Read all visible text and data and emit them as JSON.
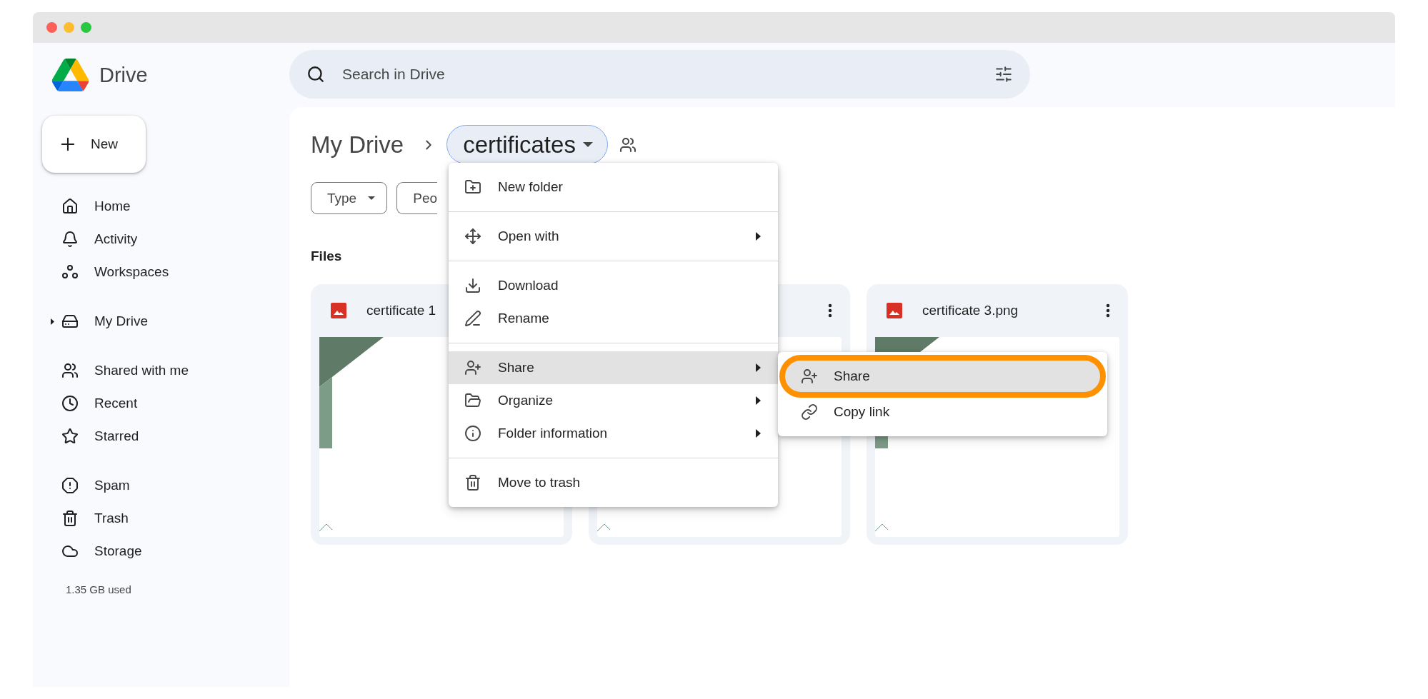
{
  "window": {
    "app_name": "Drive"
  },
  "search": {
    "placeholder": "Search in Drive"
  },
  "new_button": "New",
  "sidebar": {
    "groups": [
      {
        "items": [
          {
            "label": "Home"
          },
          {
            "label": "Activity"
          },
          {
            "label": "Workspaces"
          }
        ]
      },
      {
        "items": [
          {
            "label": "My Drive",
            "expanded": false
          }
        ]
      },
      {
        "items": [
          {
            "label": "Shared with me"
          },
          {
            "label": "Recent"
          },
          {
            "label": "Starred"
          }
        ]
      },
      {
        "items": [
          {
            "label": "Spam"
          },
          {
            "label": "Trash"
          },
          {
            "label": "Storage"
          }
        ]
      }
    ],
    "storage_used": "1.35 GB used"
  },
  "breadcrumb": {
    "root": "My Drive",
    "current": "certificates"
  },
  "filters": [
    {
      "label": "Type",
      "dropdown": true
    },
    {
      "label": "Peo",
      "dropdown": false
    }
  ],
  "section_title": "Files",
  "cards": [
    {
      "name": "certificate 1"
    },
    {
      "menu_button": true
    },
    {
      "name": "certificate 3.png",
      "menu_button": true
    }
  ],
  "context_menu": {
    "groups": [
      {
        "items": [
          {
            "label": "New folder",
            "submenu": false,
            "selected": false
          }
        ]
      },
      {
        "items": [
          {
            "label": "Open with",
            "submenu": true,
            "selected": false
          }
        ]
      },
      {
        "items": [
          {
            "label": "Download",
            "submenu": false,
            "selected": false
          },
          {
            "label": "Rename",
            "submenu": false,
            "selected": false
          }
        ]
      },
      {
        "items": [
          {
            "label": "Share",
            "submenu": true,
            "selected": true
          },
          {
            "label": "Organize",
            "submenu": true,
            "selected": false
          },
          {
            "label": "Folder information",
            "submenu": true,
            "selected": false
          }
        ]
      },
      {
        "items": [
          {
            "label": "Move to trash",
            "submenu": false,
            "selected": false
          }
        ]
      }
    ]
  },
  "submenu": {
    "items": [
      {
        "label": "Share",
        "selected": true
      },
      {
        "label": "Copy link",
        "selected": false
      }
    ]
  }
}
